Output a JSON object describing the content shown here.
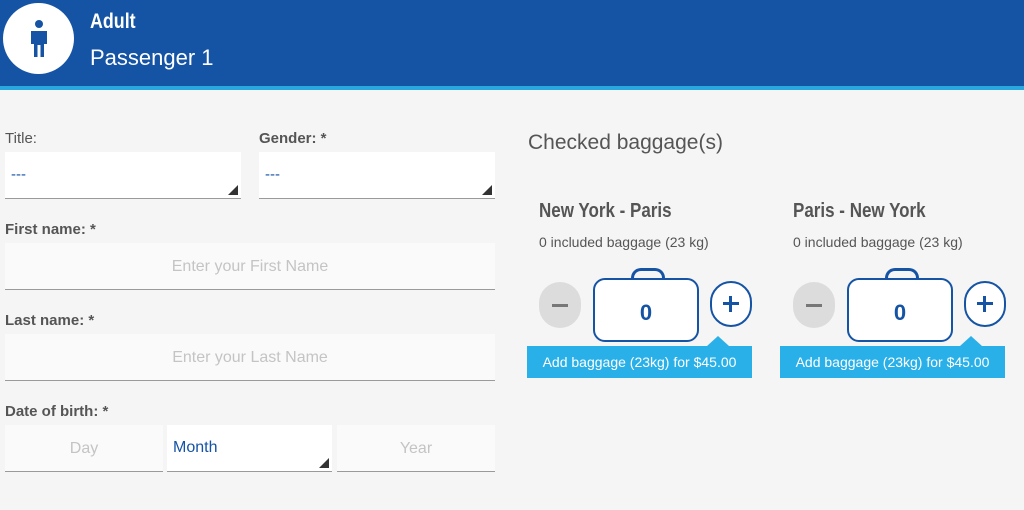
{
  "header": {
    "type": "Adult",
    "name": "Passenger 1",
    "icon": "person-icon"
  },
  "form": {
    "title_label": "Title:",
    "title_value": "---",
    "gender_label": "Gender: *",
    "gender_value": "---",
    "first_name_label": "First name: *",
    "first_name_placeholder": "Enter your First Name",
    "last_name_label": "Last name: *",
    "last_name_placeholder": "Enter your Last Name",
    "dob_label": "Date of birth: *",
    "dob_day_placeholder": "Day",
    "dob_month_value": "Month",
    "dob_year_placeholder": "Year"
  },
  "baggage": {
    "title": "Checked baggage(s)",
    "routes": [
      {
        "route": "New York - Paris",
        "included": "0 included baggage (23 kg)",
        "count": "0",
        "add_label": "Add baggage (23kg) for $45.00"
      },
      {
        "route": "Paris - New York",
        "included": "0 included baggage (23 kg)",
        "count": "0",
        "add_label": "Add baggage (23kg) for $45.00"
      }
    ]
  },
  "colors": {
    "header": "#1553a5",
    "accent": "#2ab0e8",
    "stripe": "#29a8e0"
  }
}
